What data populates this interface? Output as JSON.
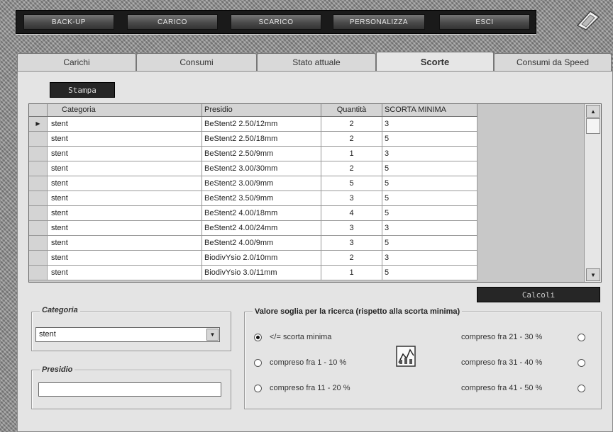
{
  "topbar": {
    "buttons": [
      "BACK-UP",
      "CARICO",
      "SCARICO",
      "PERSONALIZZA",
      "ESCI"
    ]
  },
  "tabs": [
    "Carichi",
    "Consumi",
    "Stato attuale",
    "Scorte",
    "Consumi da Speed"
  ],
  "active_tab": "Scorte",
  "stampa_label": "Stampa",
  "grid": {
    "columns": [
      "Categoria",
      "Presidio",
      "Quantità",
      "SCORTA MINIMA"
    ],
    "rows": [
      [
        "stent",
        "BeStent2 2.50/12mm",
        "2",
        "3"
      ],
      [
        "stent",
        "BeStent2 2.50/18mm",
        "2",
        "5"
      ],
      [
        "stent",
        "BeStent2 2.50/9mm",
        "1",
        "3"
      ],
      [
        "stent",
        "BeStent2 3.00/30mm",
        "2",
        "5"
      ],
      [
        "stent",
        "BeStent2 3.00/9mm",
        "5",
        "5"
      ],
      [
        "stent",
        "BeStent2 3.50/9mm",
        "3",
        "5"
      ],
      [
        "stent",
        "BeStent2 4.00/18mm",
        "4",
        "5"
      ],
      [
        "stent",
        "BeStent2 4.00/24mm",
        "3",
        "3"
      ],
      [
        "stent",
        "BeStent2 4.00/9mm",
        "3",
        "5"
      ],
      [
        "stent",
        "BiodivYsio 2.0/10mm",
        "2",
        "3"
      ],
      [
        "stent",
        "BiodivYsio 3.0/11mm",
        "1",
        "5"
      ]
    ]
  },
  "calcoli_label": "Calcoli",
  "categoria": {
    "legend": "Categoria",
    "value": "stent"
  },
  "presidio": {
    "legend": "Presidio",
    "value": ""
  },
  "soglia": {
    "title": "Valore soglia per la ricerca (rispetto alla scorta minima)",
    "options_left": [
      "</= scorta minima",
      "compreso fra 1 - 10 %",
      "compreso fra 11 - 20 %"
    ],
    "options_right": [
      "compreso fra 21 - 30 %",
      "compreso fra 31 - 40 %",
      "compreso fra 41 - 50 %"
    ],
    "selected": "</= scorta minima"
  }
}
